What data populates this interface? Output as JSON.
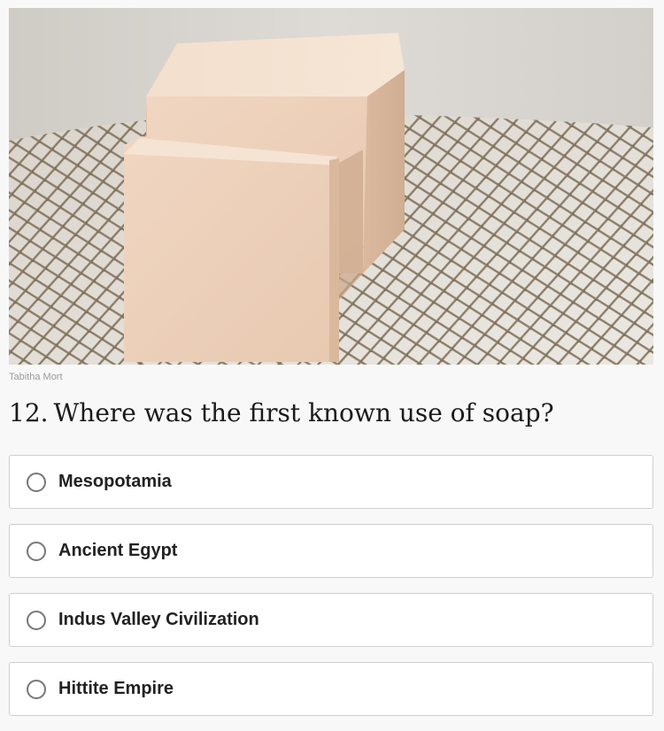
{
  "image": {
    "subject": "soap-bars-on-netting",
    "credit": "Tabitha Mort"
  },
  "quiz": {
    "question_number": "12.",
    "question_text": "Where was the first known use of soap?",
    "answers": [
      {
        "label": "Mesopotamia"
      },
      {
        "label": "Ancient Egypt"
      },
      {
        "label": "Indus Valley Civilization"
      },
      {
        "label": "Hittite Empire"
      }
    ]
  },
  "colors": {
    "page_background": "#f8f8f8",
    "answer_border": "#cfcfcf",
    "radio_border": "#777777"
  }
}
